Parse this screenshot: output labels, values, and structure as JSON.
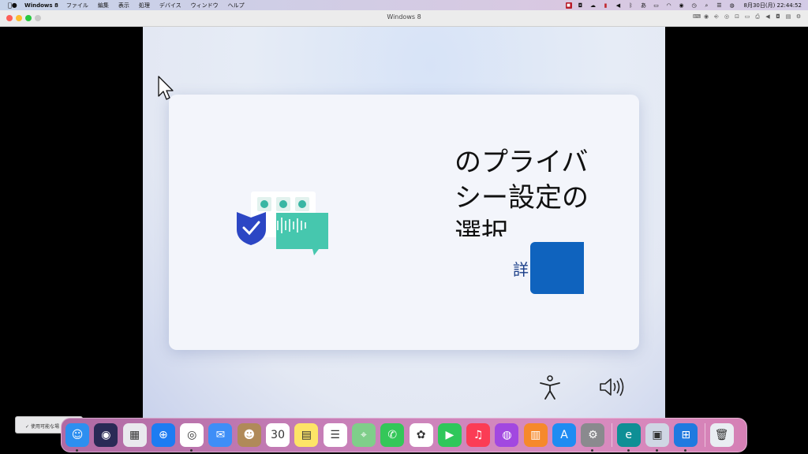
{
  "menubar": {
    "app_name": "Windows 8",
    "menus": [
      "ファイル",
      "編集",
      "表示",
      "処理",
      "デバイス",
      "ウィンドウ",
      "ヘルプ"
    ],
    "clock": "8月30日(月) 22:44:52",
    "status_icons": [
      "parallels-icon",
      "onedrive-icon",
      "cloud-icon",
      "red-app-icon",
      "volume-icon",
      "bluetooth-icon",
      "input-method-icon",
      "battery-icon",
      "wifi-icon",
      "user-icon",
      "timemachine-icon",
      "search-icon",
      "controlcenter-icon",
      "siri-icon"
    ]
  },
  "window": {
    "title": "Windows 8",
    "tools": [
      "keyboard-icon",
      "record-icon",
      "usb-icon",
      "cd-icon",
      "network-icon",
      "shared-folder-icon",
      "printer-icon",
      "sound-icon",
      "camera-icon",
      "coherence-icon",
      "settings-icon"
    ]
  },
  "setup": {
    "heading": "のプライバシー設定の選択",
    "learn_more": "詳",
    "illustration": "privacy-illustration"
  },
  "sidebar": {
    "note": "使用可能な場"
  },
  "dock": {
    "apps": [
      {
        "name": "finder",
        "color": "#2d8ff0",
        "glyph": "☺",
        "running": true
      },
      {
        "name": "siri",
        "color": "#2a2a56",
        "glyph": "◉",
        "running": false
      },
      {
        "name": "launchpad",
        "color": "#e9e9ee",
        "glyph": "▦",
        "running": false
      },
      {
        "name": "safari",
        "color": "#1d7cf2",
        "glyph": "⊕",
        "running": false
      },
      {
        "name": "chrome",
        "color": "#ffffff",
        "glyph": "◎",
        "running": true
      },
      {
        "name": "mail",
        "color": "#3e8ef7",
        "glyph": "✉",
        "running": false
      },
      {
        "name": "contacts",
        "color": "#b08a59",
        "glyph": "☻",
        "running": false
      },
      {
        "name": "calendar",
        "color": "#ffffff",
        "glyph": "30",
        "running": false
      },
      {
        "name": "notes",
        "color": "#fde467",
        "glyph": "▤",
        "running": false
      },
      {
        "name": "reminders",
        "color": "#ffffff",
        "glyph": "☰",
        "running": false
      },
      {
        "name": "maps",
        "color": "#7fce8a",
        "glyph": "⌖",
        "running": false
      },
      {
        "name": "messages",
        "color": "#34c759",
        "glyph": "✆",
        "running": false
      },
      {
        "name": "photos",
        "color": "#ffffff",
        "glyph": "✿",
        "running": false
      },
      {
        "name": "facetime",
        "color": "#2fc75b",
        "glyph": "▶",
        "running": false
      },
      {
        "name": "music",
        "color": "#fb3c55",
        "glyph": "♫",
        "running": false
      },
      {
        "name": "podcasts",
        "color": "#a248e0",
        "glyph": "◍",
        "running": false
      },
      {
        "name": "books",
        "color": "#f6892b",
        "glyph": "▥",
        "running": false
      },
      {
        "name": "app-store",
        "color": "#1f8cf2",
        "glyph": "A",
        "running": false
      },
      {
        "name": "system-preferences",
        "color": "#8a8a8e",
        "glyph": "⚙",
        "running": true
      }
    ],
    "apps_right": [
      {
        "name": "eset",
        "color": "#0e8f95",
        "glyph": "e",
        "running": true
      },
      {
        "name": "parallels-control-center",
        "color": "#cfd6e4",
        "glyph": "▣",
        "running": true
      },
      {
        "name": "windows-8",
        "color": "#1f7ae0",
        "glyph": "⊞",
        "running": true
      }
    ],
    "trash": {
      "name": "trash",
      "color": "#e9edf2",
      "glyph": "🗑"
    }
  }
}
